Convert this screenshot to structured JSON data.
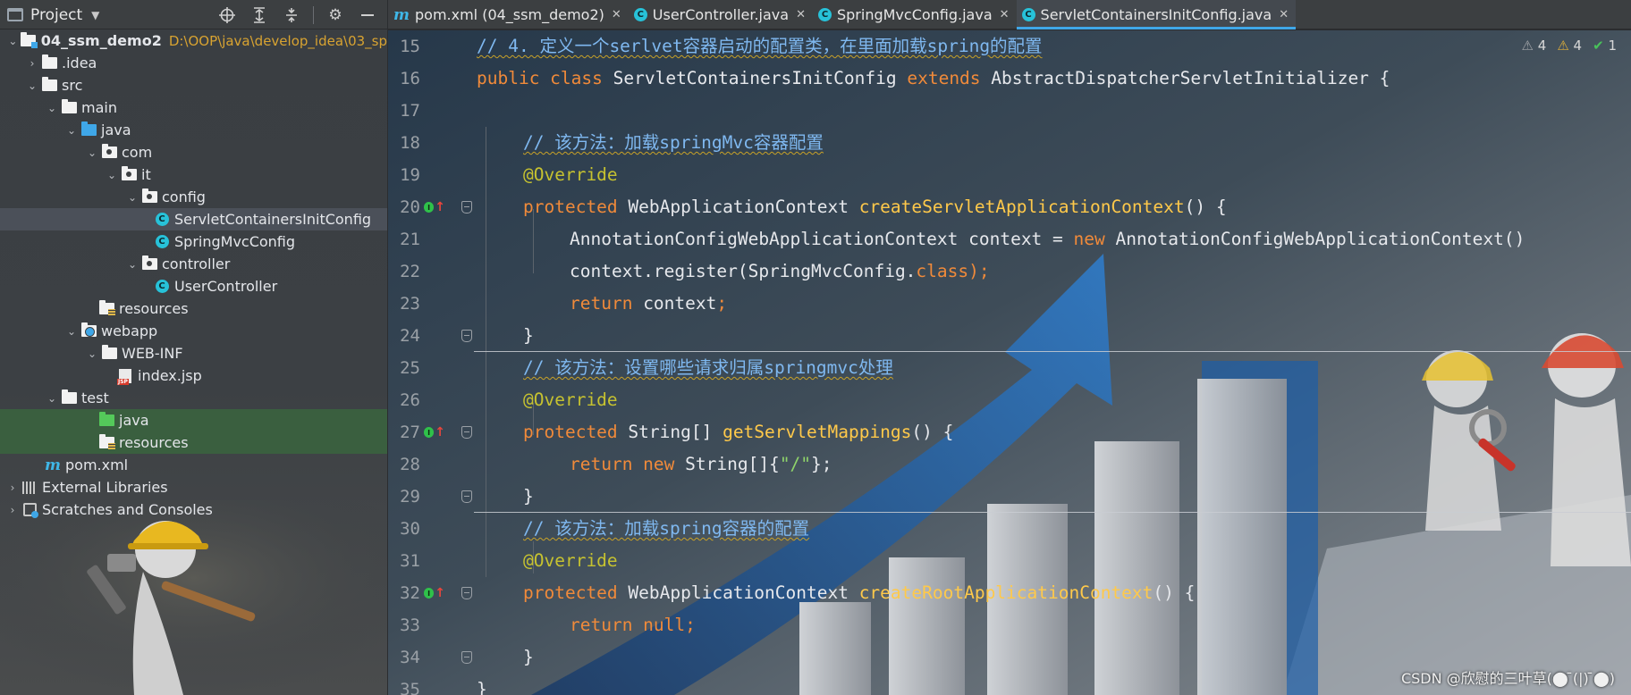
{
  "project": {
    "title": "Project",
    "tree": [
      {
        "label": "04_ssm_demo2",
        "path": "D:\\OOP\\java\\develop_idea\\03_sp",
        "icon": "module-folder-icon",
        "bold": true
      },
      {
        "label": ".idea",
        "icon": "folder-icon"
      },
      {
        "label": "src",
        "icon": "folder-icon"
      },
      {
        "label": "main",
        "icon": "folder-icon"
      },
      {
        "label": "java",
        "icon": "source-folder-icon"
      },
      {
        "label": "com",
        "icon": "package-icon"
      },
      {
        "label": "it",
        "icon": "package-icon"
      },
      {
        "label": "config",
        "icon": "package-icon"
      },
      {
        "label": "ServletContainersInitConfig",
        "icon": "java-class-icon",
        "selected": true
      },
      {
        "label": "SpringMvcConfig",
        "icon": "java-class-icon"
      },
      {
        "label": "controller",
        "icon": "package-icon"
      },
      {
        "label": "UserController",
        "icon": "java-class-icon"
      },
      {
        "label": "resources",
        "icon": "resources-folder-icon"
      },
      {
        "label": "webapp",
        "icon": "web-folder-icon"
      },
      {
        "label": "WEB-INF",
        "icon": "folder-icon"
      },
      {
        "label": "index.jsp",
        "icon": "jsp-file-icon"
      },
      {
        "label": "test",
        "icon": "folder-icon"
      },
      {
        "label": "java",
        "icon": "test-source-folder-icon"
      },
      {
        "label": "resources",
        "icon": "test-resources-folder-icon"
      },
      {
        "label": "pom.xml",
        "icon": "maven-icon"
      },
      {
        "label": "External Libraries",
        "icon": "libraries-icon"
      },
      {
        "label": "Scratches and Consoles",
        "icon": "scratches-icon"
      }
    ]
  },
  "tabs": [
    {
      "label": "pom.xml (04_ssm_demo2)",
      "icon": "maven-icon"
    },
    {
      "label": "UserController.java",
      "icon": "java-class-icon"
    },
    {
      "label": "SpringMvcConfig.java",
      "icon": "java-class-icon"
    },
    {
      "label": "ServletContainersInitConfig.java",
      "icon": "java-class-icon",
      "active": true
    }
  ],
  "inspections": {
    "weak_warnings": "4",
    "warnings": "4",
    "typos": "1"
  },
  "editor": {
    "line_numbers": [
      "15",
      "16",
      "17",
      "18",
      "19",
      "20",
      "21",
      "22",
      "23",
      "24",
      "25",
      "26",
      "27",
      "28",
      "29",
      "30",
      "31",
      "32",
      "33",
      "34",
      "35"
    ],
    "code": {
      "l15": "// 4. 定义一个serlvet容器启动的配置类，在里面加载spring的配置",
      "l16_kw1": "public class ",
      "l16_name": "ServletContainersInitConfig ",
      "l16_kw2": "extends ",
      "l16_sup": "AbstractDispatcherServletInitializer {",
      "l18": "// 该方法：加载springMvc容器配置",
      "l19": "@Override",
      "l20_kw": "protected ",
      "l20_type": "WebApplicationContext ",
      "l20_fn": "createServletApplicationContext",
      "l20_end": "() {",
      "l21_a": "AnnotationConfigWebApplicationContext context = ",
      "l21_kw": "new ",
      "l21_b": "AnnotationConfigWebApplicationContext()",
      "l22_a": "context.register(SpringMvcConfig.",
      "l22_kw": "class",
      "l22_b": ");",
      "l23_kw": "return ",
      "l23_b": "context",
      "l23_c": ";",
      "l24": "}",
      "l25": "// 该方法：设置哪些请求归属springmvc处理",
      "l26": "@Override",
      "l27_kw": "protected ",
      "l27_type": "String[] ",
      "l27_fn": "getServletMappings",
      "l27_end": "() {",
      "l28_kw": "return new ",
      "l28_a": "String[]{",
      "l28_st": "\"/\"",
      "l28_b": "};",
      "l29": "}",
      "l30": "// 该方法：加载spring容器的配置",
      "l31": "@Override",
      "l32_kw": "protected ",
      "l32_type": "WebApplicationContext ",
      "l32_fn": "createRootApplicationContext",
      "l32_end": "() {",
      "l33_kw": "return null",
      "l33_b": ";",
      "l34": "}",
      "l35": "}"
    }
  },
  "watermark": "CSDN @欣慰的三叶草(⬤ ̄(|) ̄⬤)",
  "colors": {
    "accent": "#3fa7e8",
    "keyword": "#f08a3a",
    "function": "#ffc94a",
    "annotation": "#c6c230",
    "comment": "#7fb8f0"
  }
}
